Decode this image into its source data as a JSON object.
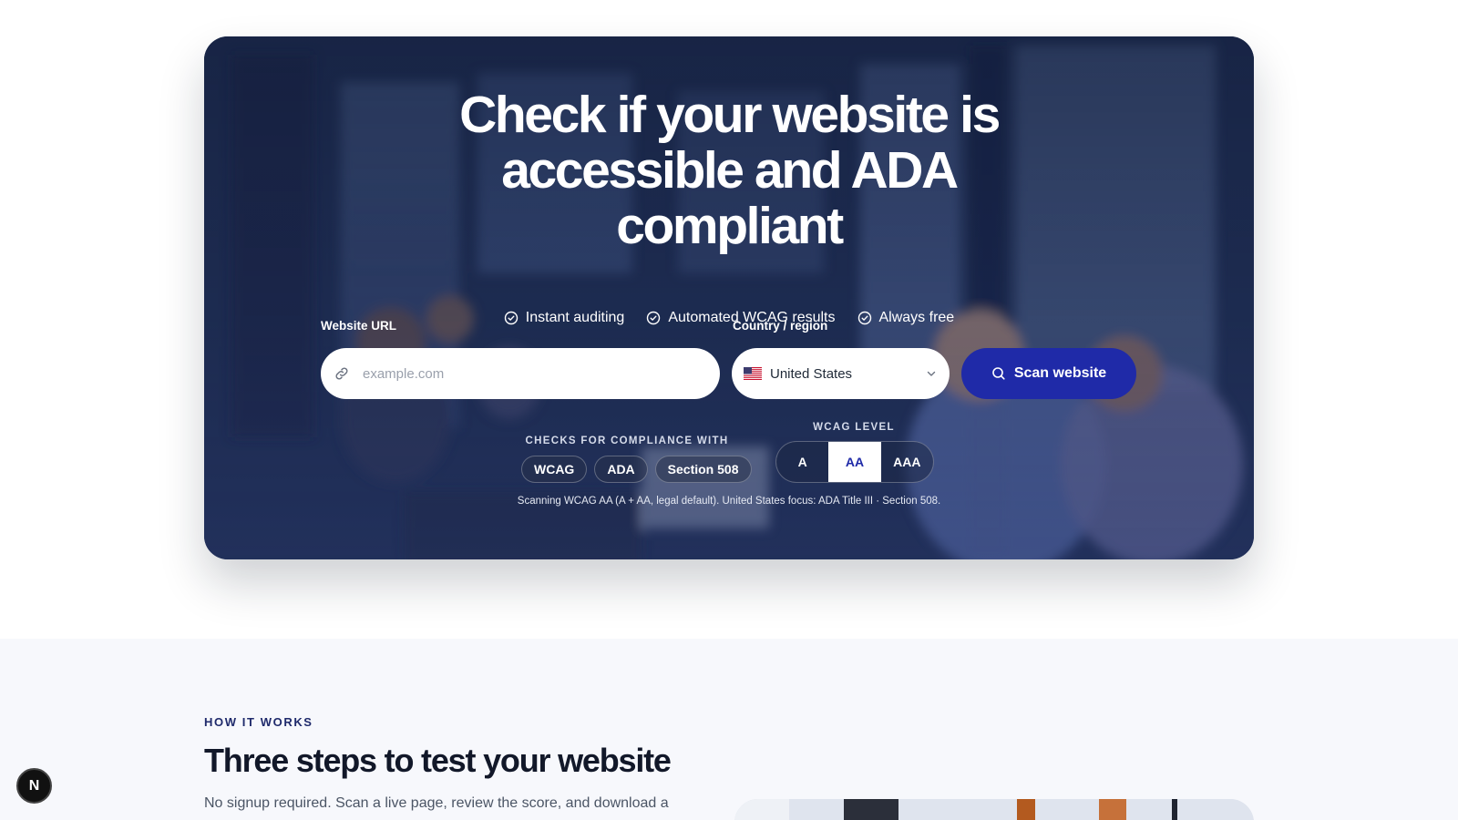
{
  "hero": {
    "title_lines": [
      "Check if your website is",
      "accessible and ADA",
      "compliant"
    ],
    "features": [
      {
        "label": "Instant auditing",
        "icon": "check-circle-icon"
      },
      {
        "label": "Automated WCAG results",
        "icon": "check-circle-icon"
      },
      {
        "label": "Always free",
        "icon": "check-circle-icon"
      }
    ],
    "url_field": {
      "label": "Website URL",
      "placeholder": "example.com",
      "value": "",
      "icon": "link-icon"
    },
    "country_field": {
      "label": "Country / region",
      "value": "United States",
      "flag": "us-flag-icon"
    },
    "scan_button": {
      "label": "Scan website",
      "icon": "search-icon"
    },
    "compliance": {
      "heading": "CHECKS FOR COMPLIANCE WITH",
      "chips": [
        "WCAG",
        "ADA",
        "Section 508"
      ]
    },
    "wcag_level": {
      "heading": "WCAG LEVEL",
      "options": [
        "A",
        "AA",
        "AAA"
      ],
      "selected": "AA"
    },
    "scan_note": "Scanning WCAG AA (A + AA, legal default). United States focus: ADA Title III · Section 508."
  },
  "how_it_works": {
    "eyebrow": "HOW IT WORKS",
    "title": "Three steps to test your website",
    "description": "No signup required. Scan a live page, review the score, and download a"
  },
  "badge": {
    "label": "N"
  },
  "colors": {
    "primary": "#1f2aa8",
    "hero_overlay": "#1a2744",
    "eyebrow": "#1f2a6b",
    "section_bg": "#f7f8fc"
  }
}
